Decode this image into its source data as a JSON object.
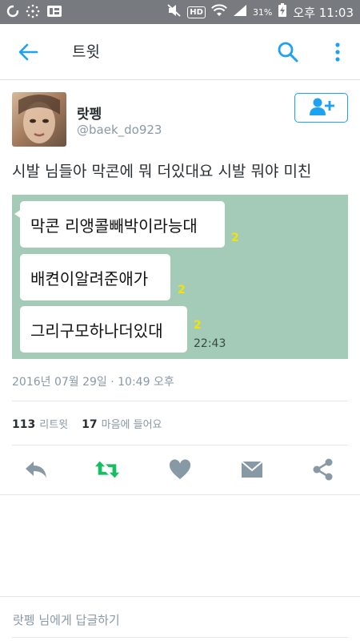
{
  "status_bar": {
    "left_icons": [
      "clock-app-icon",
      "dots-app-icon",
      "photo-app-icon"
    ],
    "hd_label": "HD",
    "battery_percent": "31%",
    "time": "오후 11:03"
  },
  "header": {
    "title": "트윗"
  },
  "tweet": {
    "user_name": "랏펭",
    "user_handle": "@baek_do923",
    "text": "시발 님들아 막콘에 뭐 더있대요 시발 뭐야 미친",
    "timestamp": "2016년 07월 29일 · 10:49 오후",
    "retweet_count": "113",
    "retweet_label": "리트윗",
    "like_count": "17",
    "like_label": "마음에 들어요"
  },
  "media": {
    "messages": [
      {
        "text": "막콘 리앵콜빼박이라능대",
        "unread": "2"
      },
      {
        "text": "배켠이알려준애가",
        "unread": "2"
      },
      {
        "text": "그리구모하나더있대",
        "unread": "2"
      }
    ],
    "time": "22:43"
  },
  "actions": [
    "reply-icon",
    "retweet-icon",
    "like-icon",
    "message-icon",
    "share-icon"
  ],
  "reply": {
    "placeholder": "랏펭 님에게 답글하기"
  },
  "colors": {
    "accent": "#1da1f2",
    "retweet": "#17bf63",
    "muted": "#8899a6",
    "chat_bg": "#a3cbb8"
  }
}
